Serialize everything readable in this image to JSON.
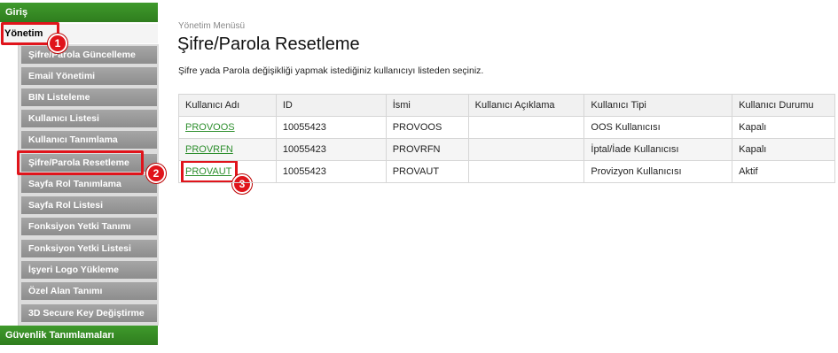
{
  "sidebar": {
    "giris_label": "Giriş",
    "yonetim_label": "Yönetim",
    "items": [
      {
        "label": "Şifre/Parola Güncelleme"
      },
      {
        "label": "Email Yönetimi"
      },
      {
        "label": "BIN Listeleme"
      },
      {
        "label": "Kullanıcı Listesi"
      },
      {
        "label": "Kullanıcı Tanımlama"
      },
      {
        "label": "Şifre/Parola Resetleme"
      },
      {
        "label": "Sayfa Rol Tanımlama"
      },
      {
        "label": "Sayfa Rol Listesi"
      },
      {
        "label": "Fonksiyon Yetki Tanımı"
      },
      {
        "label": "Fonksiyon Yetki Listesi"
      },
      {
        "label": "İşyeri Logo Yükleme"
      },
      {
        "label": "Özel Alan Tanımı"
      },
      {
        "label": "3D Secure Key Değiştirme"
      }
    ],
    "guvenlik_label": "Güvenlik Tanımlamaları"
  },
  "markers": {
    "one": "1",
    "two": "2",
    "three": "3"
  },
  "main": {
    "breadcrumb": "Yönetim Menüsü",
    "title": "Şifre/Parola Resetleme",
    "instruction": "Şifre yada Parola değişikliği yapmak istediğiniz kullanıcıyı listeden seçiniz.",
    "columns": [
      "Kullanıcı Adı",
      "ID",
      "İsmi",
      "Kullanıcı Açıklama",
      "Kullanıcı Tipi",
      "Kullanıcı Durumu"
    ],
    "rows": [
      {
        "username": "PROVOOS",
        "id": "10055423",
        "name": "PROVOOS",
        "desc": "",
        "type": "OOS Kullanıcısı",
        "status": "Kapalı"
      },
      {
        "username": "PROVRFN",
        "id": "10055423",
        "name": "PROVRFN",
        "desc": "",
        "type": "İptal/İade Kullanıcısı",
        "status": "Kapalı"
      },
      {
        "username": "PROVAUT",
        "id": "10055423",
        "name": "PROVAUT",
        "desc": "",
        "type": "Provizyon Kullanıcısı",
        "status": "Aktif"
      }
    ]
  },
  "colors": {
    "green": "#3f9a2c",
    "highlight": "#e0141b",
    "link": "#2e8f2e"
  }
}
